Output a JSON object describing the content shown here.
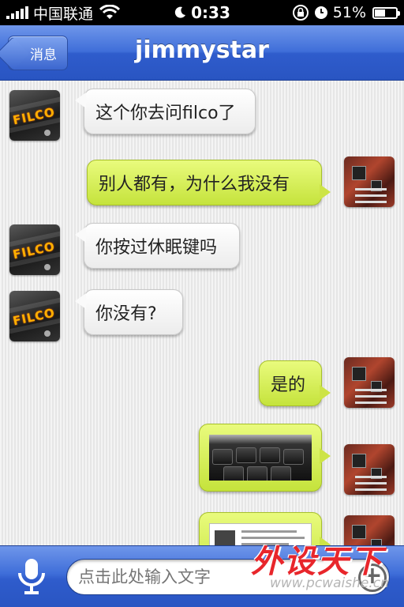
{
  "status_bar": {
    "carrier": "中国联通",
    "time": "0:33",
    "battery": "51%",
    "battery_level": 0.51,
    "signal_bars": 5
  },
  "nav_bar": {
    "back_label": "消息",
    "title": "jimmystar"
  },
  "messages": [
    {
      "side": "in",
      "text": "这个你去问filco了",
      "avatar": "filco-avatar"
    },
    {
      "side": "out",
      "text": "别人都有，为什么我没有",
      "avatar": "motherboard-avatar"
    },
    {
      "side": "in",
      "text": "你按过休眠键吗",
      "avatar": "filco-avatar"
    },
    {
      "side": "in",
      "text": "你没有?",
      "avatar": "filco-avatar"
    },
    {
      "side": "out",
      "text": "是的",
      "avatar": "motherboard-avatar"
    },
    {
      "side": "out",
      "type": "image",
      "avatar": "motherboard-avatar"
    },
    {
      "side": "out",
      "type": "image",
      "avatar": "motherboard-avatar"
    }
  ],
  "filco_avatar_text": "FILCO",
  "input_bar": {
    "placeholder": "点击此处输入文字"
  },
  "watermark": {
    "title": "外设天下",
    "url": "www.pcwaishe.cn"
  },
  "colors": {
    "nav_blue": "#3f6ed9",
    "incoming_bubble": "#ffffff",
    "outgoing_bubble": "#d6ef55"
  }
}
